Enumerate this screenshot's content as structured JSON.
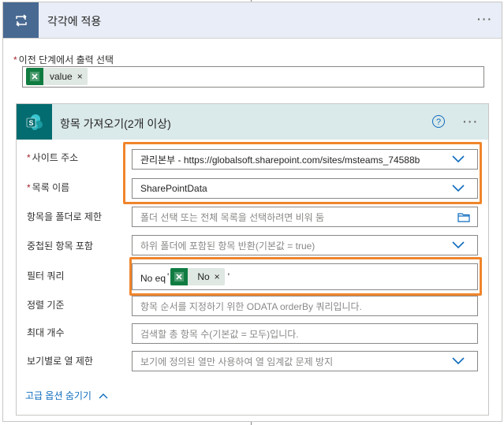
{
  "outer": {
    "title": "각각에 적용",
    "more": "···",
    "prev_output_label": "이전 단계에서 출력 선택",
    "token_value": "value",
    "token_close": "×"
  },
  "inner": {
    "title": "항목 가져오기(2개 이상)",
    "help": "?",
    "more": "···",
    "rows": {
      "site": {
        "label": "사이트 주소",
        "value": "관리본부 - https://globalsoft.sharepoint.com/sites/msteams_74588b"
      },
      "list": {
        "label": "목록 이름",
        "value": "SharePointData"
      },
      "folder": {
        "label": "항목을 폴더로 제한",
        "placeholder": "폴더 선택 또는 전체 목록을 선택하려면 비워 둠"
      },
      "nested": {
        "label": "중첩된 항목 포함",
        "placeholder": "하위 폴더에 포함된 항목 반환(기본값 = true)"
      },
      "filter": {
        "label": "필터 쿼리",
        "prefix": "No eq",
        "quote_open": "'",
        "token": "No",
        "token_close": "×",
        "quote_close": "'"
      },
      "order": {
        "label": "정렬 기준",
        "placeholder": "항목 순서를 지정하기 위한 ODATA orderBy 쿼리입니다."
      },
      "top": {
        "label": "최대 개수",
        "placeholder": "검색할 총 항목 수(기본값 = 모두)입니다."
      },
      "view": {
        "label": "보기별로 열 제한",
        "placeholder": "보기에 정의된 열만 사용하여 열 임계값 문제 방지"
      }
    },
    "advanced": "고급 옵션 숨기기"
  },
  "colors": {
    "loop_tile": "#486991",
    "sharepoint_tile": "#036c70",
    "excel_green": "#107c41",
    "highlight": "#f0852b",
    "link": "#0f6cbd"
  },
  "icons": [
    "loop-icon",
    "excel-icon",
    "sharepoint-icon",
    "help-icon",
    "chevron-down-icon",
    "folder-icon",
    "chevron-up-icon"
  ]
}
